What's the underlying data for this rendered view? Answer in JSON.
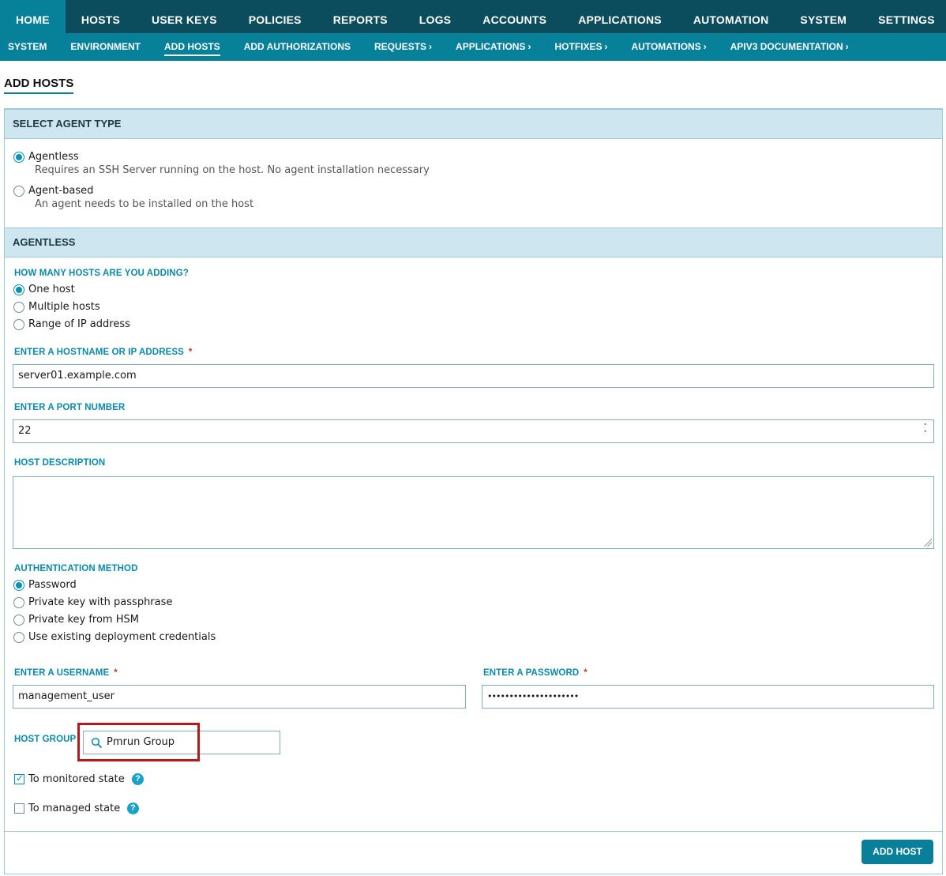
{
  "topnav": {
    "items": [
      "HOME",
      "HOSTS",
      "USER KEYS",
      "POLICIES",
      "REPORTS",
      "LOGS",
      "ACCOUNTS",
      "APPLICATIONS",
      "AUTOMATION",
      "SYSTEM",
      "SETTINGS"
    ],
    "active": "HOME"
  },
  "subnav": {
    "items": [
      "SYSTEM",
      "ENVIRONMENT",
      "ADD HOSTS",
      "ADD AUTHORIZATIONS",
      "REQUESTS",
      "APPLICATIONS",
      "HOTFIXES",
      "AUTOMATIONS",
      "APIV3 DOCUMENTATION"
    ],
    "active": "ADD HOSTS"
  },
  "page_title": "ADD HOSTS",
  "agent_type": {
    "heading": "SELECT AGENT TYPE",
    "options": [
      {
        "label": "Agentless",
        "desc": "Requires an SSH Server running on the host. No agent installation necessary",
        "selected": true
      },
      {
        "label": "Agent-based",
        "desc": "An agent needs to be installed on the host",
        "selected": false
      }
    ]
  },
  "agentless": {
    "heading": "AGENTLESS",
    "count_label": "HOW MANY HOSTS ARE YOU ADDING?",
    "count_options": [
      {
        "label": "One host",
        "selected": true
      },
      {
        "label": "Multiple hosts",
        "selected": false
      },
      {
        "label": "Range of IP address",
        "selected": false
      }
    ],
    "hostname_label": "ENTER A HOSTNAME OR IP ADDRESS",
    "hostname_value": "server01.example.com",
    "port_label": "ENTER A PORT NUMBER",
    "port_value": "22",
    "description_label": "HOST DESCRIPTION",
    "auth_label": "AUTHENTICATION METHOD",
    "auth_options": [
      {
        "label": "Password",
        "selected": true
      },
      {
        "label": "Private key with passphrase",
        "selected": false
      },
      {
        "label": "Private key from HSM",
        "selected": false
      },
      {
        "label": "Use existing deployment credentials",
        "selected": false
      }
    ],
    "username_label": "ENTER A USERNAME",
    "username_value": "management_user",
    "password_label": "ENTER A PASSWORD",
    "password_value": "•••••••••••••••••••••",
    "host_group_label": "HOST GROUP",
    "host_group_value": "Pmrun Group",
    "monitored_label": "To monitored state",
    "monitored_checked": true,
    "managed_label": "To managed state",
    "managed_checked": false,
    "required_mark": "*",
    "help_glyph": "?"
  },
  "add_button": "ADD HOST",
  "colors": {
    "topnav": "#0b4d5c",
    "subnav": "#07809a",
    "accent": "#0a8aa8",
    "highlight": "#b31b1b"
  }
}
